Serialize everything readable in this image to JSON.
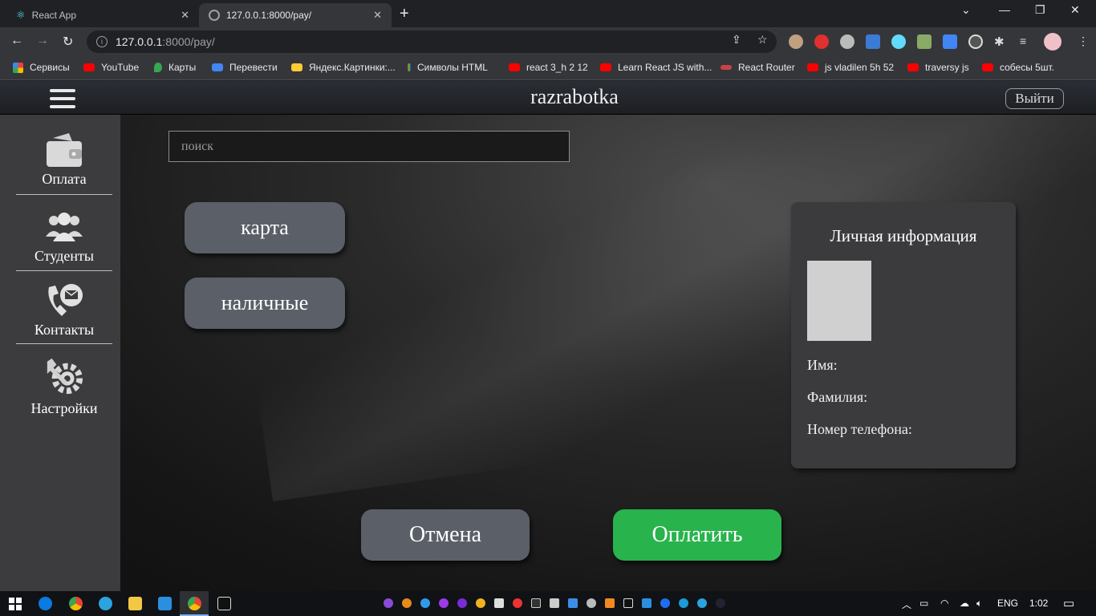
{
  "browser": {
    "tabs": [
      {
        "title": "React App",
        "active": false
      },
      {
        "title": "127.0.0.1:8000/pay/",
        "active": true
      }
    ],
    "new_tab": "+",
    "address": {
      "host": "127.0.0.1",
      "path": ":8000/pay/"
    },
    "bookmarks": [
      "Сервисы",
      "YouTube",
      "Карты",
      "Перевести",
      "Яндекс.Картинки:...",
      "Символы HTML",
      "react 3_h 2 12",
      "Learn React JS with...",
      "React Router",
      "js vladilen 5h 52",
      "traversy js",
      "собесы 5шт."
    ]
  },
  "app": {
    "brand": "razrabotka",
    "logout_label": "Выйти",
    "sidebar": [
      {
        "label": "Оплата",
        "icon": "wallet-icon"
      },
      {
        "label": "Студенты",
        "icon": "students-icon"
      },
      {
        "label": "Контакты",
        "icon": "contacts-icon"
      },
      {
        "label": "Настройки",
        "icon": "settings-icon"
      }
    ],
    "search_placeholder": "поиск",
    "payment_methods": [
      "карта",
      "наличные"
    ],
    "info_card": {
      "title": "Личная информация",
      "name_label": "Имя:",
      "surname_label": "Фамилия:",
      "phone_label": "Номер телефона:"
    },
    "cancel_label": "Отмена",
    "pay_label": "Оплатить",
    "colors": {
      "pay": "#28b34c",
      "button": "#5a5f68",
      "sidebar": "#3c3c3e"
    }
  },
  "taskbar": {
    "lang": "ENG",
    "time": "1:02"
  }
}
